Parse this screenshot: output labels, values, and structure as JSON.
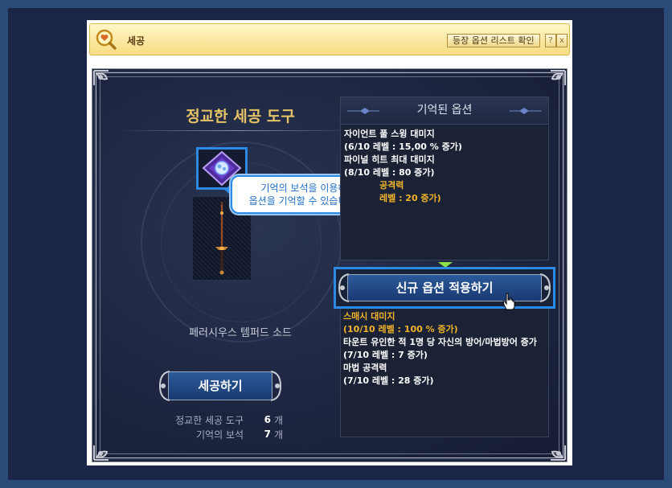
{
  "window": {
    "title": "세공",
    "option_list_button": "등장 옵션 리스트 확인",
    "help_label": "?",
    "close_label": "x"
  },
  "left": {
    "title": "정교한 세공 도구",
    "item_name": "페러시우스 템퍼드 소드",
    "tooltip_line1": "기억의 보석을 이용해",
    "tooltip_line2": "옵션을 기억할 수 있습니다.",
    "craft_button": "세공하기",
    "counts": [
      {
        "label": "정교한 세공 도구",
        "value": "6",
        "unit": "개"
      },
      {
        "label": "기억의 보석",
        "value": "7",
        "unit": "개"
      }
    ]
  },
  "remembered": {
    "header": "기억된 옵션",
    "options": [
      {
        "name": "자이언트 풀 스윙 대미지",
        "detail": "(6/10 레벨 : 15,00 % 증가)",
        "gold": false
      },
      {
        "name": "파이널 히트 최대 대미지",
        "detail": "(8/10 레벨 : 80 증가)",
        "gold": false
      },
      {
        "name": "공격력",
        "detail": "레벨 : 20 증가)",
        "gold": true
      }
    ]
  },
  "apply": {
    "button": "신규 옵션 적용하기"
  },
  "new_options": [
    {
      "name": "스매시 대미지",
      "detail": "(10/10 레벨 : 100 % 증가)",
      "gold": true
    },
    {
      "name": "타운트 유인한 적 1명 당 자신의 방어/마법방어 증가",
      "detail": "(7/10 레벨 : 7 증가)",
      "gold": false
    },
    {
      "name": "마법 공격력",
      "detail": "(7/10 레벨 : 28 증가)",
      "gold": false
    }
  ],
  "colors": {
    "accent_blue": "#2a8ae6",
    "gold": "#f1b428",
    "title_gold": "#e6c466"
  }
}
